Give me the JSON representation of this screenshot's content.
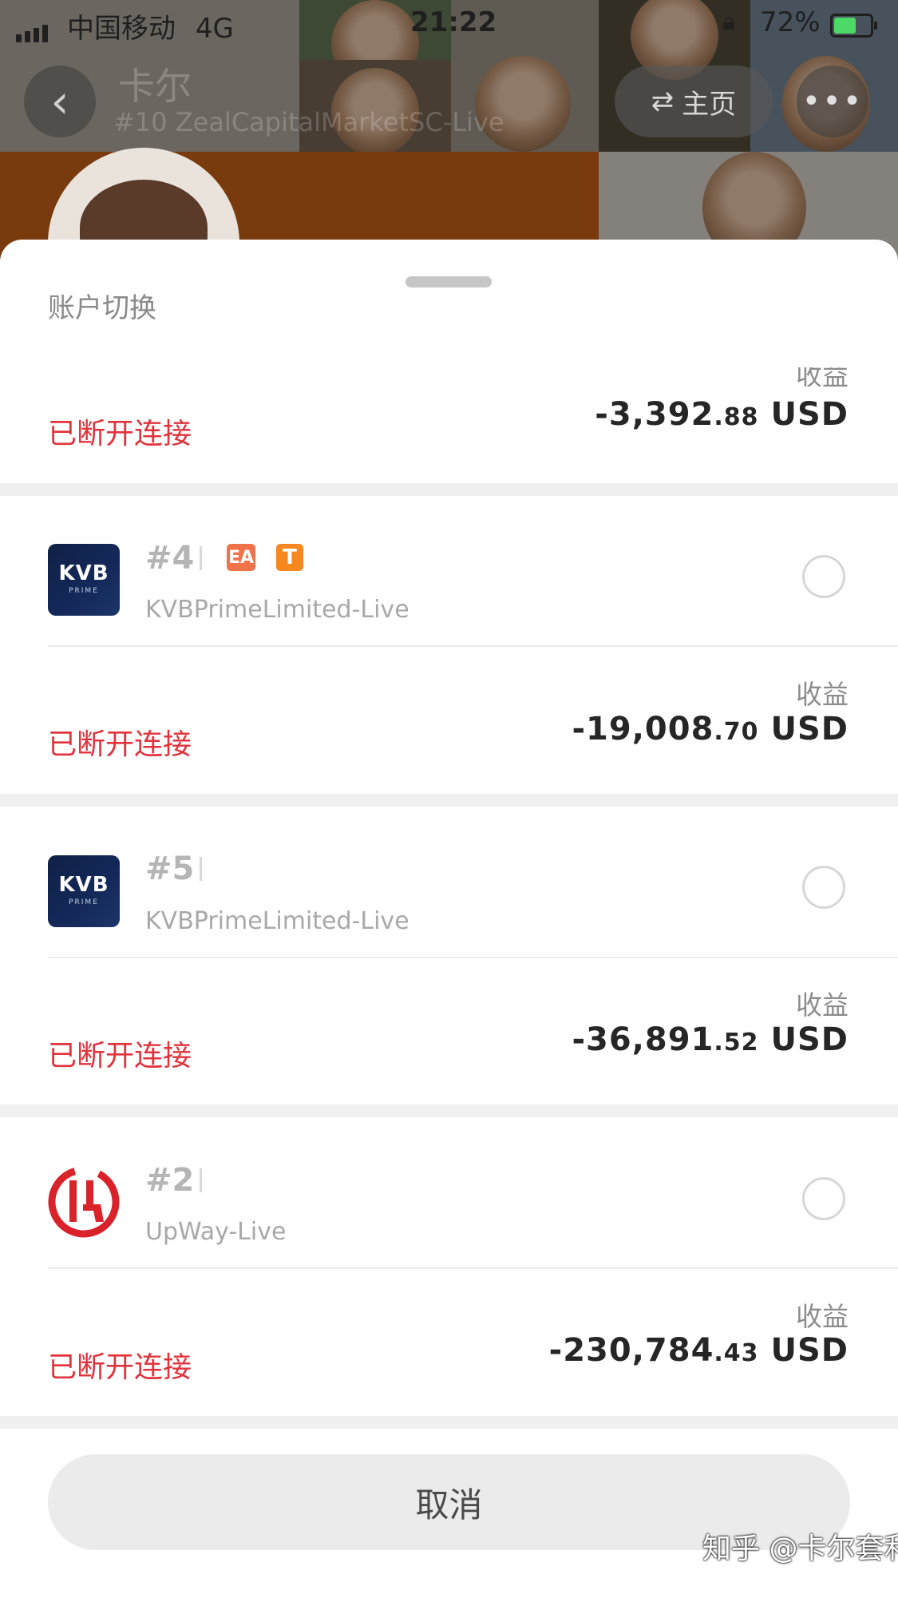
{
  "status_bar": {
    "carrier": "中国移动",
    "network": "4G",
    "time": "21:22",
    "battery_percent": "72%",
    "battery_level": 0.72
  },
  "profile_header": {
    "name": "卡尔",
    "subtitle": "#10 ZealCapitalMarketSC-Live",
    "home_button": "主页"
  },
  "sheet": {
    "title": "账户切换",
    "partial_account": {
      "return_label": "收益",
      "pnl_main": "-3,392",
      "pnl_cents": ".88",
      "currency": "USD",
      "status": "已断开连接"
    },
    "accounts": [
      {
        "number": "#4",
        "badges": [
          "EA",
          "T"
        ],
        "broker": "KVBPrimeLimited-Live",
        "logo": "kvb-prime-logo",
        "return_label": "收益",
        "pnl_main": "-19,008",
        "pnl_cents": ".70",
        "currency": "USD",
        "status": "已断开连接"
      },
      {
        "number": "#5",
        "badges": [],
        "broker": "KVBPrimeLimited-Live",
        "logo": "kvb-prime-logo",
        "return_label": "收益",
        "pnl_main": "-36,891",
        "pnl_cents": ".52",
        "currency": "USD",
        "status": "已断开连接"
      },
      {
        "number": "#2",
        "badges": [],
        "broker": "UpWay-Live",
        "logo": "upway-logo",
        "return_label": "收益",
        "pnl_main": "-230,784",
        "pnl_cents": ".43",
        "currency": "USD",
        "status": "已断开连接"
      }
    ],
    "cancel_label": "取消"
  },
  "logos": {
    "kvb_text": "KVB",
    "kvb_sub": "PRIME"
  },
  "watermark": "知乎 @卡尔套利",
  "colors": {
    "disconnected": "#e0333c",
    "badge_ea": "#f0734a",
    "badge_t": "#f5891f",
    "header_orange": "#cc5a12"
  }
}
